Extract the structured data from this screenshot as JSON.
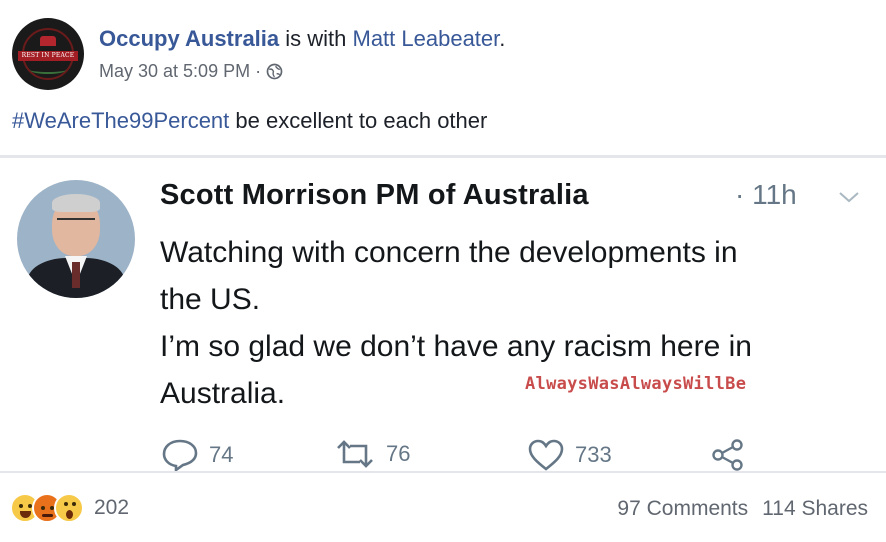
{
  "post": {
    "page_name": "Occupy Australia",
    "with_text": " is with ",
    "tagged_user": "Matt Leabeater",
    "period": ".",
    "timestamp": "May 30 at 5:09 PM",
    "separator": "·",
    "privacy_icon": "globe-icon",
    "avatar_banner_text": "REST IN PEACE",
    "hashtag": "#WeAreThe99Percent",
    "text": " be excellent to each other"
  },
  "tweet": {
    "author": "Scott Morrison PM of Australia",
    "time": "· 11h",
    "lines": [
      "Watching with concern the developments in",
      "the US.",
      "I’m so glad we don’t have any racism here in",
      "Australia."
    ],
    "watermark": "AlwaysWasAlwaysWillBe",
    "actions": {
      "replies": "74",
      "retweets": "76",
      "likes": "733"
    },
    "icons": [
      "reply-icon",
      "retweet-icon",
      "like-icon",
      "share-icon",
      "chevron-down-icon"
    ]
  },
  "footer": {
    "reactions": [
      "haha-emoji",
      "angry-emoji",
      "wow-emoji"
    ],
    "reaction_count": "202",
    "comments": "97 Comments",
    "shares": "114 Shares"
  },
  "colors": {
    "facebook_link": "#385898",
    "meta_gray": "#616770",
    "twitter_gray": "#657786",
    "watermark_red": "#c94c4c"
  }
}
